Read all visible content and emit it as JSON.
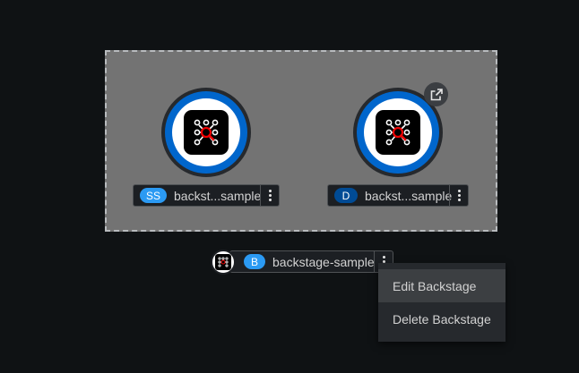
{
  "group": {
    "nodes": [
      {
        "badge": "SS",
        "badge_color": "#2b9af3",
        "label": "backst...sample"
      },
      {
        "badge": "D",
        "badge_color": "#004b95",
        "label": "backst...sample"
      }
    ]
  },
  "application": {
    "badge": "B",
    "badge_color": "#2b9af3",
    "label": "backstage-sample"
  },
  "context_menu": {
    "items": [
      "Edit Backstage",
      "Delete Backstage"
    ]
  },
  "icons": {
    "external_link": "external-link-icon",
    "kebab": "kebab-menu-icon",
    "node": "backstage-topology-icon"
  },
  "colors": {
    "ring_blue": "#0066cc",
    "group_fill": "#737373",
    "background": "#0f1214"
  }
}
